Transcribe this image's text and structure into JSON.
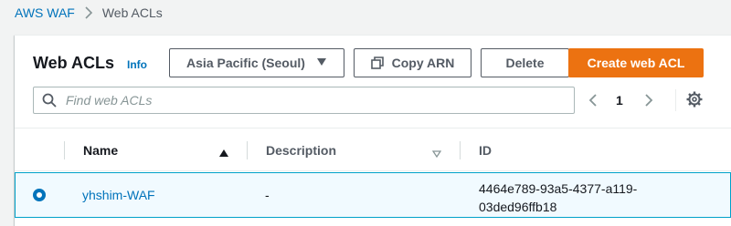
{
  "breadcrumb": {
    "root": "AWS WAF",
    "current": "Web ACLs"
  },
  "header": {
    "title": "Web ACLs",
    "info": "Info"
  },
  "toolbar": {
    "region": "Asia Pacific (Seoul)",
    "copy_arn": "Copy ARN",
    "delete": "Delete",
    "create": "Create web ACL"
  },
  "search": {
    "placeholder": "Find web ACLs",
    "value": ""
  },
  "pagination": {
    "current_page": "1"
  },
  "table": {
    "columns": [
      "Name",
      "Description",
      "ID"
    ],
    "rows": [
      {
        "name": "yhshim-WAF",
        "description": "-",
        "id": "4464e789-93a5-4377-a119-03ded96ffb18",
        "selected": true
      }
    ]
  },
  "colors": {
    "accent": "#ec7211",
    "link": "#0073bb",
    "selected_border": "#00a1c9",
    "selected_bg": "#f1faff"
  },
  "icons": [
    "chevron-right-icon",
    "caret-down-icon",
    "copy-icon",
    "search-icon",
    "chevron-left-icon",
    "chevron-right-icon",
    "gear-icon",
    "sort-asc-icon",
    "sort-icon"
  ]
}
